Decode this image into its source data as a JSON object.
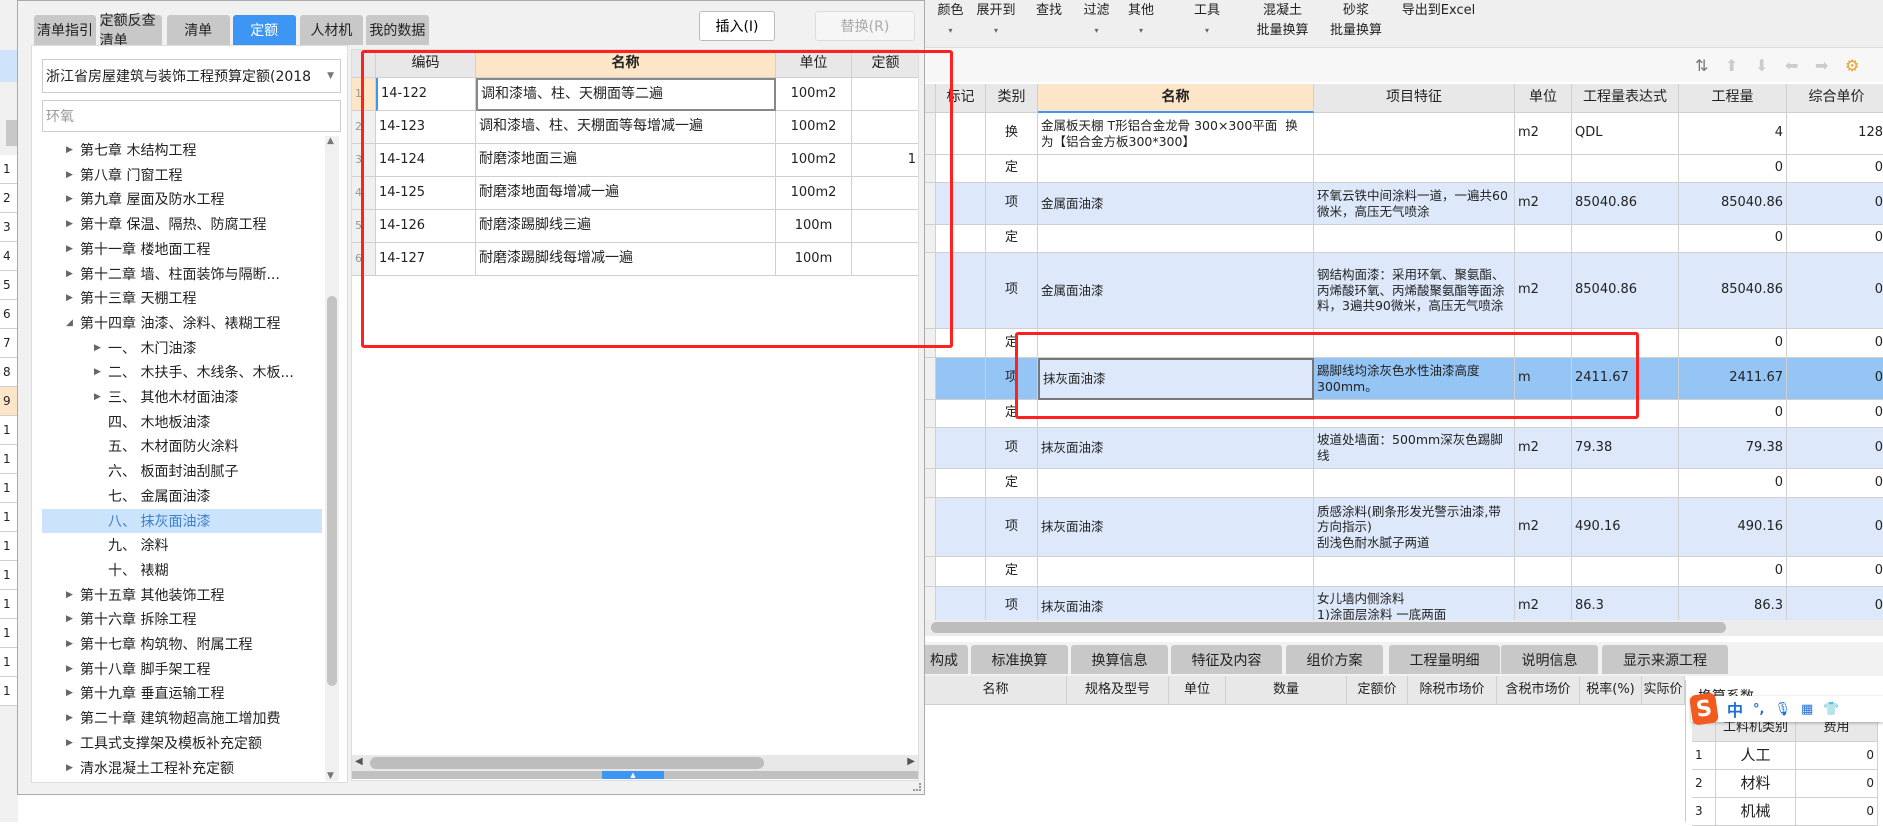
{
  "colors": {
    "accent": "#3d95f4",
    "selected_row": "#95c5f5",
    "alt_row": "#dde9fb",
    "header_highlight": "#fde6c8",
    "annotation": "#ff2020"
  },
  "bg_left_rows": [
    "1",
    "2",
    "3",
    "4",
    "5",
    "6",
    "7",
    "8",
    "9",
    "1",
    "1",
    "1",
    "1",
    "1",
    "1",
    "1",
    "1",
    "1",
    "1"
  ],
  "toolbar": {
    "items": [
      {
        "l1": "颜色",
        "l2": "▾"
      },
      {
        "l1": "展开到",
        "l2": "▾"
      },
      {
        "l1": "查找",
        "l2": ""
      },
      {
        "l1": "过滤",
        "l2": "▾"
      },
      {
        "l1": "其他",
        "l2": "▾"
      },
      {
        "l1": "工具",
        "l2": "▾"
      },
      {
        "l1": "混凝土",
        "l2": "批量换算"
      },
      {
        "l1": "砂浆",
        "l2": "批量换算"
      },
      {
        "l1": "导出到Excel",
        "l2": ""
      }
    ],
    "icons": [
      "sort-icon",
      "arrow-up-icon",
      "arrow-down-icon",
      "arrow-left-icon",
      "arrow-right-icon",
      "settings-icon"
    ]
  },
  "main_grid": {
    "headers": [
      "",
      "标记",
      "类别",
      "名称",
      "项目特征",
      "单位",
      "工程量表达式",
      "工程量",
      "综合单价"
    ],
    "rows": [
      {
        "type": "换",
        "name": "金属板天棚 T形铝合金龙骨 300×300平面  换为【铝合金方板300*300】",
        "feature": "",
        "unit": "m2",
        "expr": "QDL",
        "qty": "4",
        "price": "128",
        "style": "white"
      },
      {
        "type": "定",
        "name": "",
        "feature": "",
        "unit": "",
        "expr": "",
        "qty": "0",
        "price": "0",
        "style": "white"
      },
      {
        "type": "项",
        "name": "金属面油漆",
        "feature": "环氧云铁中间涂料一道，一遍共60微米，高压无气喷涂",
        "unit": "m2",
        "expr": "85040.86",
        "qty": "85040.86",
        "price": "0",
        "style": "alt"
      },
      {
        "type": "定",
        "name": "",
        "feature": "",
        "unit": "",
        "expr": "",
        "qty": "0",
        "price": "0",
        "style": "white"
      },
      {
        "type": "项",
        "name": "金属面油漆",
        "feature": "钢结构面漆：采用环氧、聚氨酯、丙烯酸环氧、丙烯酸聚氨酯等面涂料，3遍共90微米，高压无气喷涂",
        "unit": "m2",
        "expr": "85040.86",
        "qty": "85040.86",
        "price": "0",
        "style": "alt"
      },
      {
        "type": "定",
        "name": "",
        "feature": "",
        "unit": "",
        "expr": "",
        "qty": "0",
        "price": "0",
        "style": "white"
      },
      {
        "type": "项",
        "name": "抹灰面油漆",
        "feature": "踢脚线均涂灰色水性油漆高度300mm。",
        "unit": "m",
        "expr": "2411.67",
        "qty": "2411.67",
        "price": "0",
        "style": "sel"
      },
      {
        "type": "定",
        "name": "",
        "feature": "",
        "unit": "",
        "expr": "",
        "qty": "0",
        "price": "0",
        "style": "white"
      },
      {
        "type": "项",
        "name": "抹灰面油漆",
        "feature": "坡道处墙面：500mm深灰色踢脚线",
        "unit": "m2",
        "expr": "79.38",
        "qty": "79.38",
        "price": "0",
        "style": "alt"
      },
      {
        "type": "定",
        "name": "",
        "feature": "",
        "unit": "",
        "expr": "",
        "qty": "0",
        "price": "0",
        "style": "white"
      },
      {
        "type": "项",
        "name": "抹灰面油漆",
        "feature": "质感涂料(刷条形发光警示油漆,带方向指示)\n刮浅色耐水腻子两道",
        "unit": "m2",
        "expr": "490.16",
        "qty": "490.16",
        "price": "0",
        "style": "alt"
      },
      {
        "type": "定",
        "name": "",
        "feature": "",
        "unit": "",
        "expr": "",
        "qty": "0",
        "price": "0",
        "style": "white"
      },
      {
        "type": "项",
        "name": "抹灰面油漆",
        "feature": "女儿墙内侧涂料\n1)涂面层涂料 一底两面",
        "unit": "m2",
        "expr": "86.3",
        "qty": "86.3",
        "price": "0",
        "style": "alt"
      }
    ]
  },
  "bottom_tabs": [
    "构成",
    "标准换算",
    "换算信息",
    "特征及内容",
    "组价方案",
    "工程量明细",
    "说明信息",
    "显示来源工程"
  ],
  "bottom_headers": [
    "名称",
    "规格及型号",
    "单位",
    "数量",
    "定额价",
    "除税市场价",
    "含税市场价",
    "税率(%)",
    "实际价"
  ],
  "coef_panel": {
    "title": "换算系数",
    "headers": [
      "",
      "工料机类别",
      "费用"
    ],
    "rows": [
      [
        "1",
        "人工",
        "0"
      ],
      [
        "2",
        "材料",
        "0"
      ],
      [
        "3",
        "机械",
        "0"
      ]
    ]
  },
  "ime": {
    "logo": "S",
    "items": [
      "中",
      "°,",
      "mic-icon",
      "keyboard-icon",
      "skin-icon"
    ]
  },
  "dialog": {
    "tabs": [
      "清单指引",
      "定额反查清单",
      "清单",
      "定额",
      "人材机",
      "我的数据"
    ],
    "active_tab": 3,
    "insert_label": "插入(I)",
    "replace_label": "替换(R)",
    "library_select": "浙江省房屋建筑与装饰工程预算定额(2018",
    "search_value": "环氧",
    "tree": [
      {
        "label": "第七章 木结构工程",
        "level": 0,
        "arrow": "▶"
      },
      {
        "label": "第八章 门窗工程",
        "level": 0,
        "arrow": "▶"
      },
      {
        "label": "第九章 屋面及防水工程",
        "level": 0,
        "arrow": "▶"
      },
      {
        "label": "第十章 保温、隔热、防腐工程",
        "level": 0,
        "arrow": "▶"
      },
      {
        "label": "第十一章 楼地面工程",
        "level": 0,
        "arrow": "▶"
      },
      {
        "label": "第十二章 墙、柱面装饰与隔断...",
        "level": 0,
        "arrow": "▶"
      },
      {
        "label": "第十三章 天棚工程",
        "level": 0,
        "arrow": "▶"
      },
      {
        "label": "第十四章 油漆、涂料、裱糊工程",
        "level": 0,
        "arrow": "◢"
      },
      {
        "label": "一、  木门油漆",
        "level": 1,
        "arrow": "▶"
      },
      {
        "label": "二、  木扶手、木线条、木板...",
        "level": 1,
        "arrow": "▶"
      },
      {
        "label": "三、  其他木材面油漆",
        "level": 1,
        "arrow": "▶"
      },
      {
        "label": "四、  木地板油漆",
        "level": 1,
        "arrow": ""
      },
      {
        "label": "五、  木材面防火涂料",
        "level": 1,
        "arrow": ""
      },
      {
        "label": "六、  板面封油刮腻子",
        "level": 1,
        "arrow": ""
      },
      {
        "label": "七、  金属面油漆",
        "level": 1,
        "arrow": ""
      },
      {
        "label": "八、  抹灰面油漆",
        "level": 1,
        "arrow": "",
        "selected": true
      },
      {
        "label": "九、  涂料",
        "level": 1,
        "arrow": ""
      },
      {
        "label": "十、  裱糊",
        "level": 1,
        "arrow": ""
      },
      {
        "label": "第十五章 其他装饰工程",
        "level": 0,
        "arrow": "▶"
      },
      {
        "label": "第十六章 拆除工程",
        "level": 0,
        "arrow": "▶"
      },
      {
        "label": "第十七章 构筑物、附属工程",
        "level": 0,
        "arrow": "▶"
      },
      {
        "label": "第十八章 脚手架工程",
        "level": 0,
        "arrow": "▶"
      },
      {
        "label": "第十九章 垂直运输工程",
        "level": 0,
        "arrow": "▶"
      },
      {
        "label": "第二十章 建筑物超高施工增加费",
        "level": 0,
        "arrow": "▶"
      },
      {
        "label": "工具式支撑架及模板补充定额",
        "level": 0,
        "arrow": "▶"
      },
      {
        "label": "清水混凝土工程补充定额",
        "level": 0,
        "arrow": "▶"
      }
    ],
    "grid_headers": [
      "",
      "编码",
      "名称",
      "单位",
      "定额"
    ],
    "grid_rows": [
      [
        "1",
        "14-122",
        "调和漆墙、柱、天棚面等二遍",
        "100m2",
        ""
      ],
      [
        "2",
        "14-123",
        "调和漆墙、柱、天棚面等每增减一遍",
        "100m2",
        ""
      ],
      [
        "3",
        "14-124",
        "耐磨漆地面三遍",
        "100m2",
        "1"
      ],
      [
        "4",
        "14-125",
        "耐磨漆地面每增减一遍",
        "100m2",
        ""
      ],
      [
        "5",
        "14-126",
        "耐磨漆踢脚线三遍",
        "100m",
        ""
      ],
      [
        "6",
        "14-127",
        "耐磨漆踢脚线每增减一遍",
        "100m",
        ""
      ]
    ]
  }
}
